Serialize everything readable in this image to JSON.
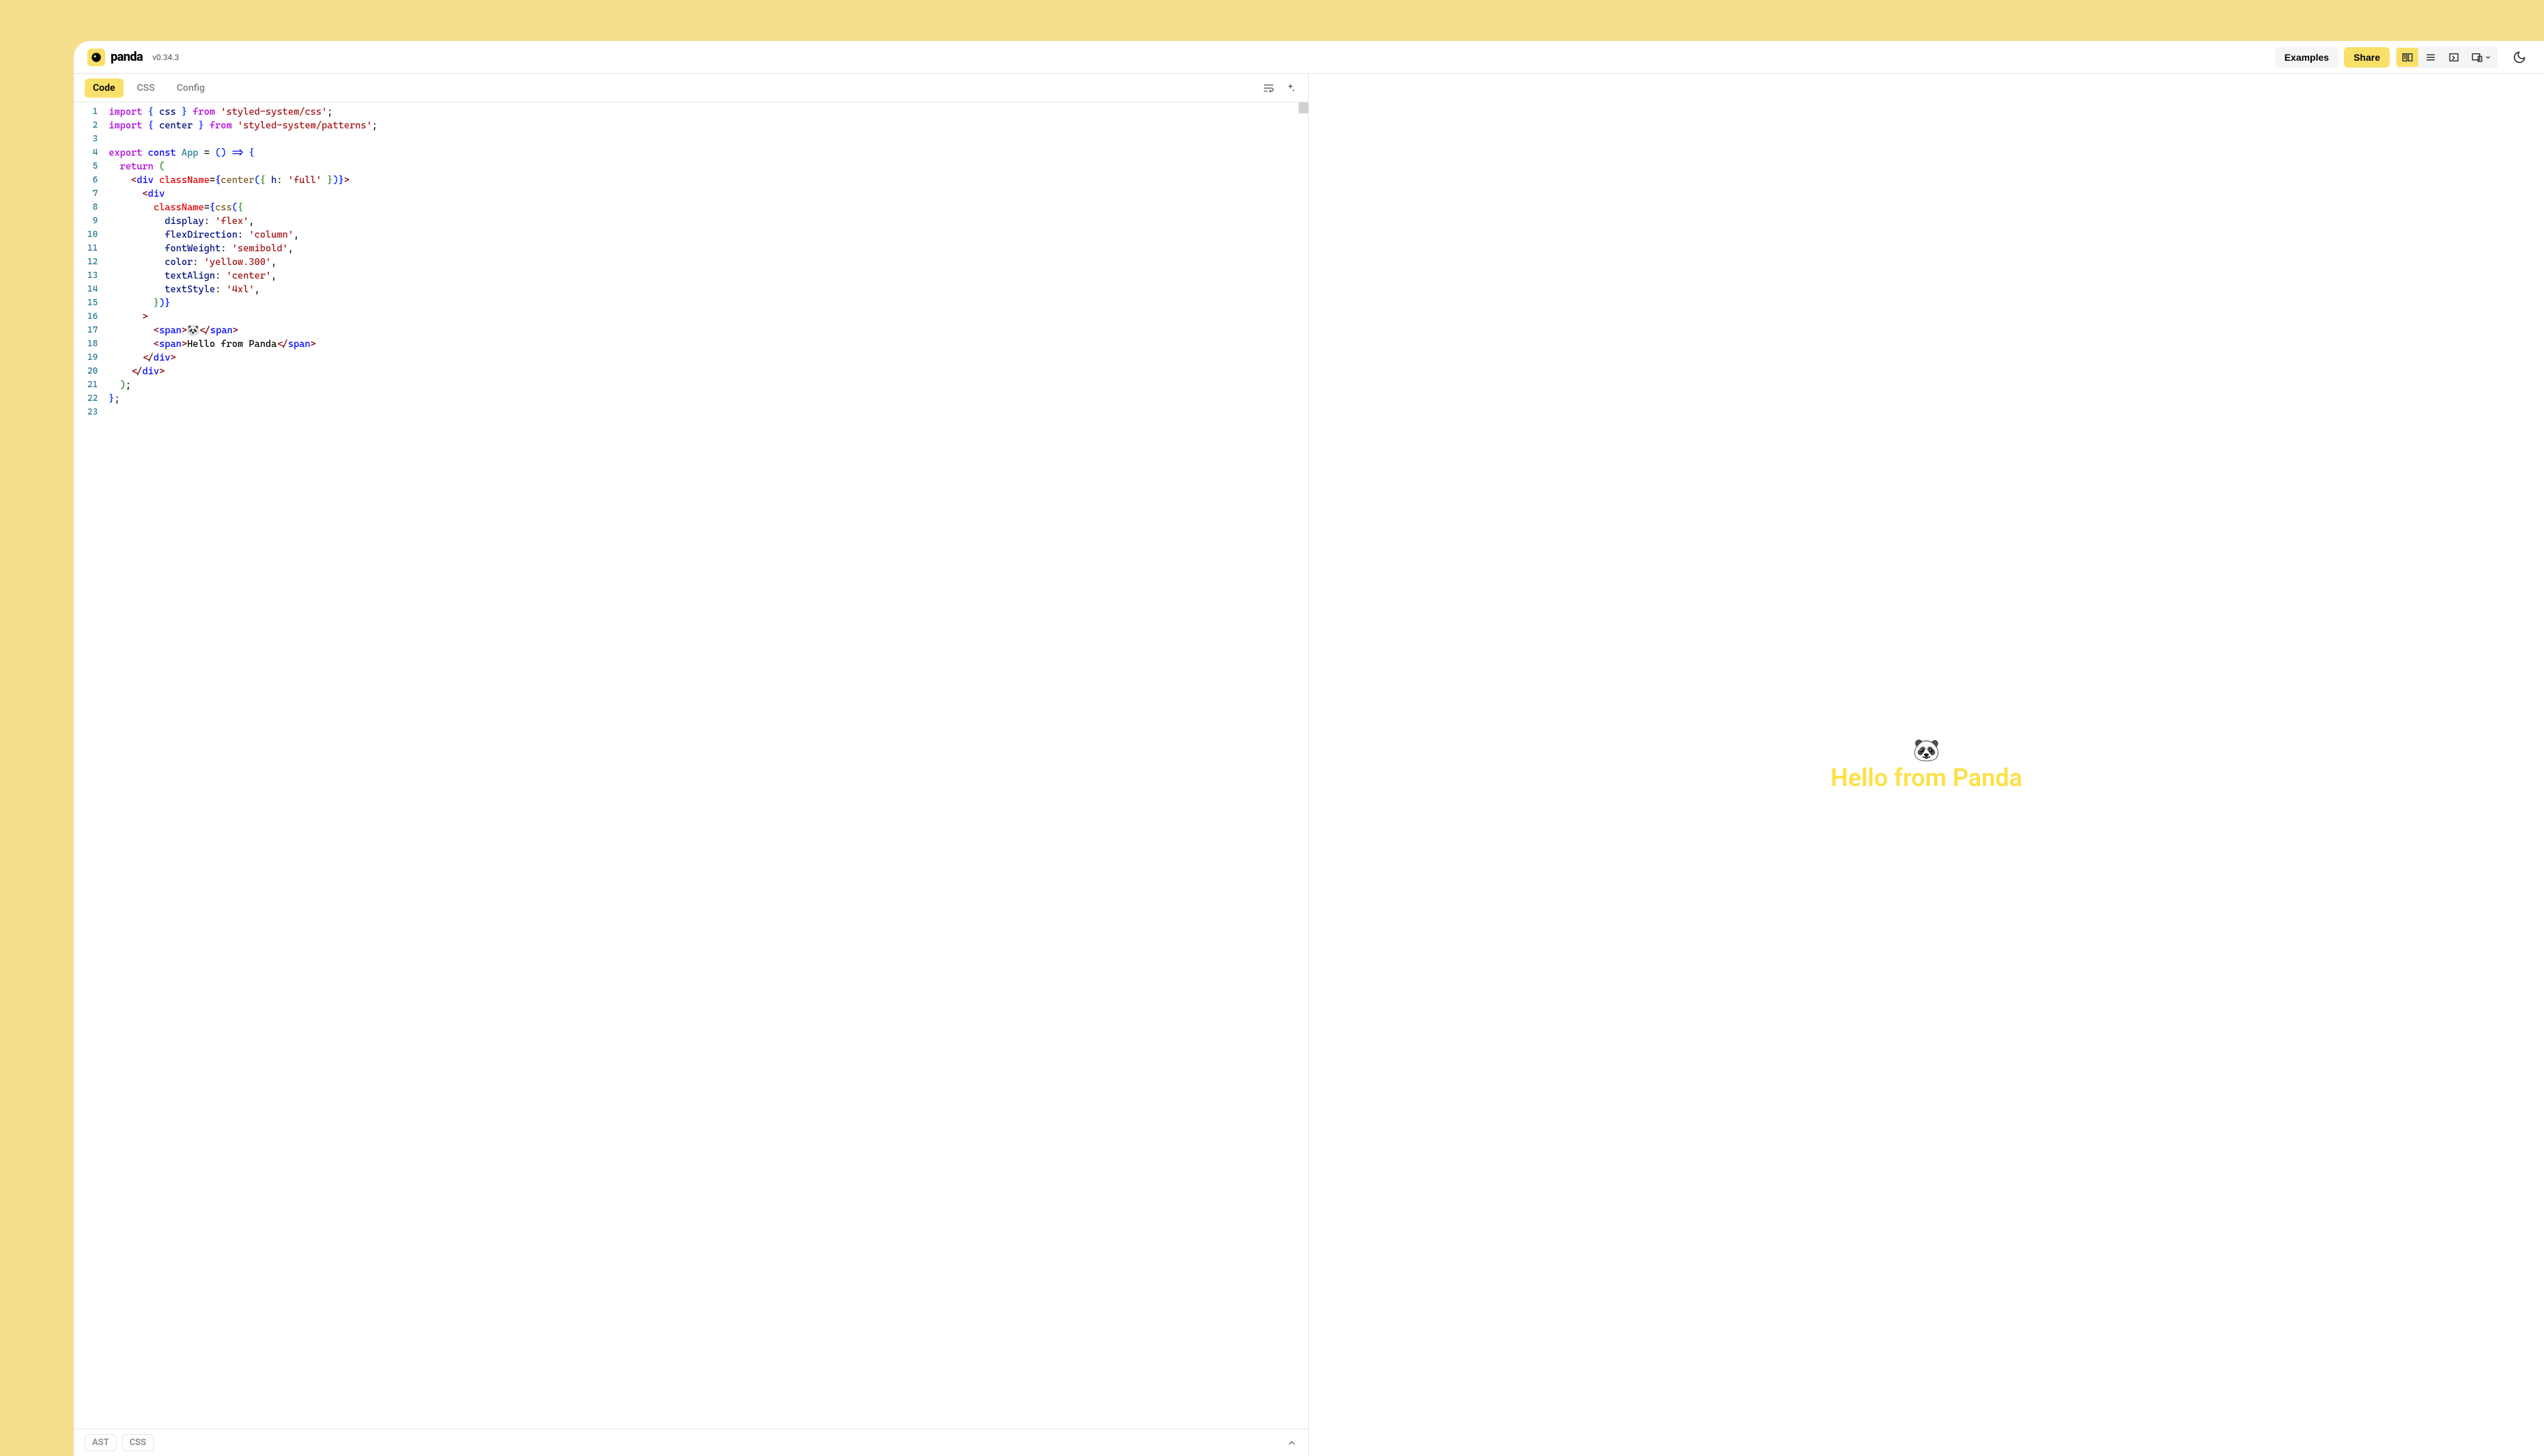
{
  "header": {
    "logo_text": "panda",
    "version": "v0.34.3",
    "examples_label": "Examples",
    "share_label": "Share"
  },
  "editor_tabs": {
    "code": "Code",
    "css": "CSS",
    "config": "Config"
  },
  "code": {
    "lines": [
      {
        "n": "1"
      },
      {
        "n": "2"
      },
      {
        "n": "3"
      },
      {
        "n": "4"
      },
      {
        "n": "5"
      },
      {
        "n": "6"
      },
      {
        "n": "7"
      },
      {
        "n": "8"
      },
      {
        "n": "9"
      },
      {
        "n": "10"
      },
      {
        "n": "11"
      },
      {
        "n": "12"
      },
      {
        "n": "13"
      },
      {
        "n": "14"
      },
      {
        "n": "15"
      },
      {
        "n": "16"
      },
      {
        "n": "17"
      },
      {
        "n": "18"
      },
      {
        "n": "19"
      },
      {
        "n": "20"
      },
      {
        "n": "21"
      },
      {
        "n": "22"
      },
      {
        "n": "23"
      }
    ],
    "source": {
      "line1_import": "import",
      "line1_css": " css ",
      "line1_from": "from",
      "line1_path": "'styled-system/css'",
      "line2_import": "import",
      "line2_center": " center ",
      "line2_from": "from",
      "line2_path": "'styled-system/patterns'",
      "line4_export": "export",
      "line4_const": "const",
      "line4_app": "App",
      "line4_arrow": " = ",
      "line4_arrow2": " => ",
      "line5_return": "return",
      "line6_div": "div",
      "line6_classname": "className",
      "line6_center": "center",
      "line6_h": " h",
      "line6_full": "'full'",
      "line7_div": "div",
      "line8_classname": "className",
      "line8_css": "css",
      "line9_display": "display",
      "line9_flex": "'flex'",
      "line10_flexdir": "flexDirection",
      "line10_column": "'column'",
      "line11_fontweight": "fontWeight",
      "line11_semibold": "'semibold'",
      "line12_color": "color",
      "line12_yellow": "'yellow.300'",
      "line13_textalign": "textAlign",
      "line13_center": "'center'",
      "line14_textstyle": "textStyle",
      "line14_4xl": "'4xl'",
      "line17_span": "span",
      "line17_emoji": "🐼",
      "line18_span": "span",
      "line18_text": "Hello from Panda",
      "line19_div": "div",
      "line20_div": "div"
    }
  },
  "bottom_bar": {
    "ast": "AST",
    "css": "CSS"
  },
  "preview": {
    "emoji": "🐼",
    "text": "Hello from Panda"
  }
}
